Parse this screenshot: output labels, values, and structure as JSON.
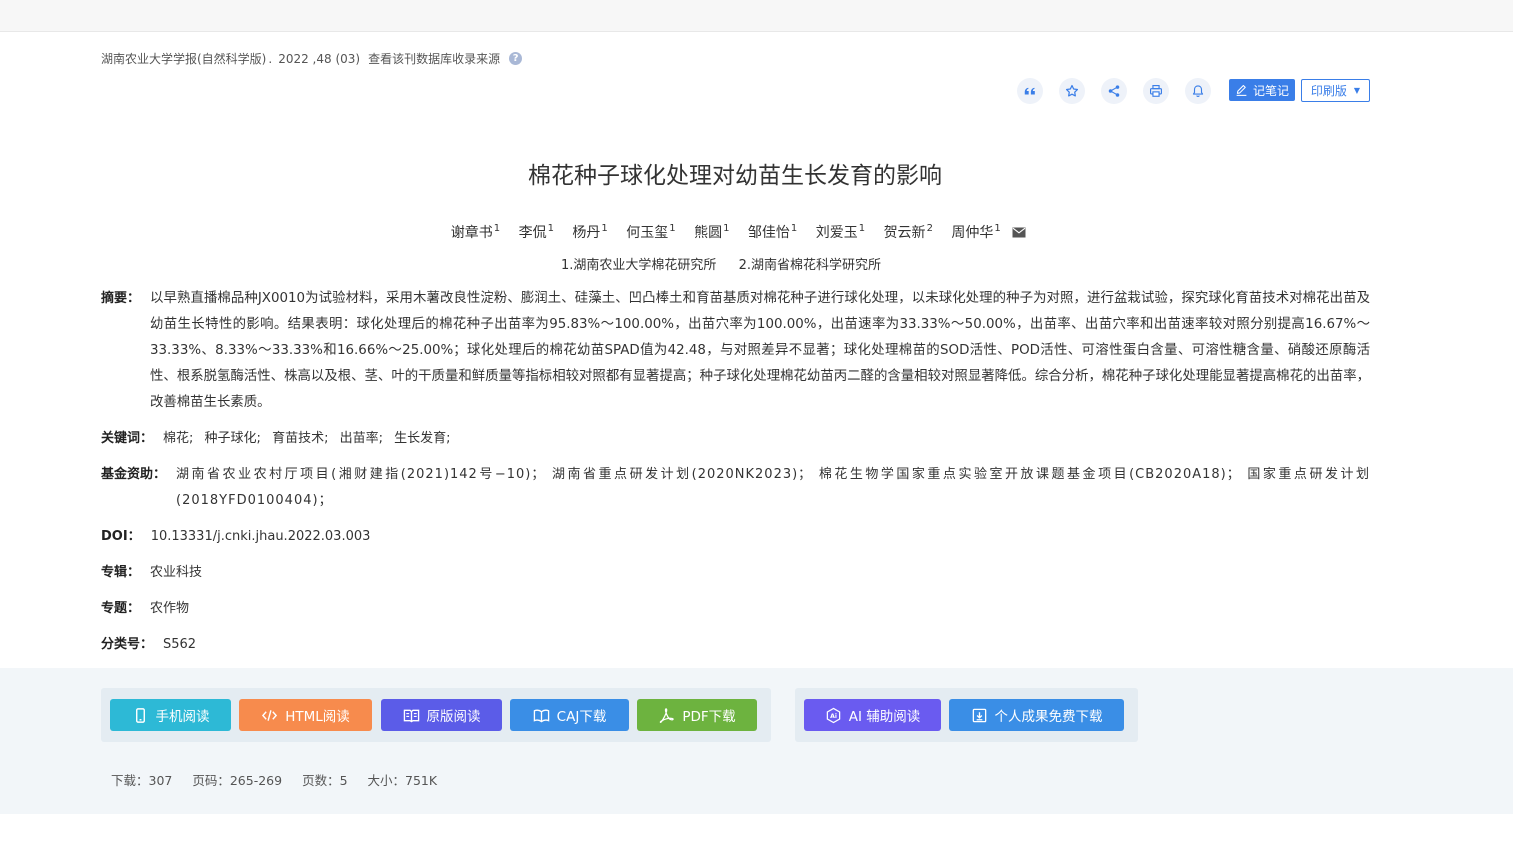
{
  "source": {
    "journal": "湖南农业大学学报(自然科学版)",
    "separator": ".",
    "issue": "2022 ,48 (03)",
    "db_link": "查看该刊数据库收录来源"
  },
  "toolbar": {
    "note_label": "记笔记",
    "print_label": "印刷版"
  },
  "article": {
    "title": "棉花种子球化处理对幼苗生长发育的影响",
    "authors": [
      {
        "name": "谢章书",
        "sup": "1"
      },
      {
        "name": "李侃",
        "sup": "1"
      },
      {
        "name": "杨丹",
        "sup": "1"
      },
      {
        "name": "何玉玺",
        "sup": "1"
      },
      {
        "name": "熊圆",
        "sup": "1"
      },
      {
        "name": "邹佳怡",
        "sup": "1"
      },
      {
        "name": "刘爱玉",
        "sup": "1"
      },
      {
        "name": "贺云新",
        "sup": "2"
      },
      {
        "name": "周仲华",
        "sup": "1"
      }
    ],
    "orgs": [
      "1.湖南农业大学棉花研究所",
      "2.湖南省棉花科学研究所"
    ]
  },
  "fields": {
    "abstract_label": "摘要：",
    "abstract": "以早熟直播棉品种JX0010为试验材料，采用木薯改良性淀粉、膨润土、硅藻土、凹凸棒土和育苗基质对棉花种子进行球化处理，以未球化处理的种子为对照，进行盆栽试验，探究球化育苗技术对棉花出苗及幼苗生长特性的影响。结果表明：球化处理后的棉花种子出苗率为95.83%～100.00%，出苗穴率为100.00%，出苗速率为33.33%～50.00%，出苗率、出苗穴率和出苗速率较对照分别提高16.67%～33.33%、8.33%～33.33%和16.66%～25.00%；球化处理后的棉花幼苗SPAD值为42.48，与对照差异不显著；球化处理棉苗的SOD活性、POD活性、可溶性蛋白含量、可溶性糖含量、硝酸还原酶活性、根系脱氢酶活性、株高以及根、茎、叶的干质量和鲜质量等指标相较对照都有显著提高；种子球化处理棉花幼苗丙二醛的含量相较对照显著降低。综合分析，棉花种子球化处理能显著提高棉花的出苗率，改善棉苗生长素质。",
    "keywords_label": "关键词：",
    "keywords": [
      "棉花;",
      "种子球化;",
      "育苗技术;",
      "出苗率;",
      "生长发育;"
    ],
    "fund_label": "基金资助：",
    "fund": "湖南省农业农村厅项目(湘财建指(2021)142号−10)；   湖南省重点研发计划(2020NK2023)；   棉花生物学国家重点实验室开放课题基金项目(CB2020A18)；   国家重点研发计划(2018YFD0100404)；",
    "doi_label": "DOI：",
    "doi": "10.13331/j.cnki.jhau.2022.03.003",
    "album_label": "专辑：",
    "album": "农业科技",
    "topic_label": "专题：",
    "topic": "农作物",
    "class_label": "分类号：",
    "class": "S562"
  },
  "actions": {
    "mobile": "手机阅读",
    "html": "HTML阅读",
    "original": "原版阅读",
    "caj": "CAJ下载",
    "pdf": "PDF下载",
    "ai": "AI 辅助阅读",
    "free": "个人成果免费下载"
  },
  "colors": {
    "mobile": "#2db9d6",
    "html": "#f78b4d",
    "original": "#5b5ce8",
    "caj": "#3a8ee6",
    "pdf": "#6db33f",
    "ai": "#6a5bf0",
    "free": "#3a8ee6",
    "accent": "#3a7ee8"
  },
  "stats": {
    "downloads": "下载：307",
    "pages": "页码：265-269",
    "page_count": "页数：5",
    "size": "大小：751K"
  },
  "icons": {
    "help": "question-circle-icon",
    "cite": "quote-icon",
    "favorite": "star-icon",
    "share": "share-icon",
    "print": "printer-icon",
    "alert": "bell-icon",
    "note": "edit-icon",
    "mail": "mail-icon",
    "mobile": "phone-icon",
    "html": "code-icon",
    "original": "book-open-icon",
    "caj": "book-icon",
    "pdf": "pdf-icon",
    "ai": "ai-icon",
    "free": "download-icon"
  }
}
